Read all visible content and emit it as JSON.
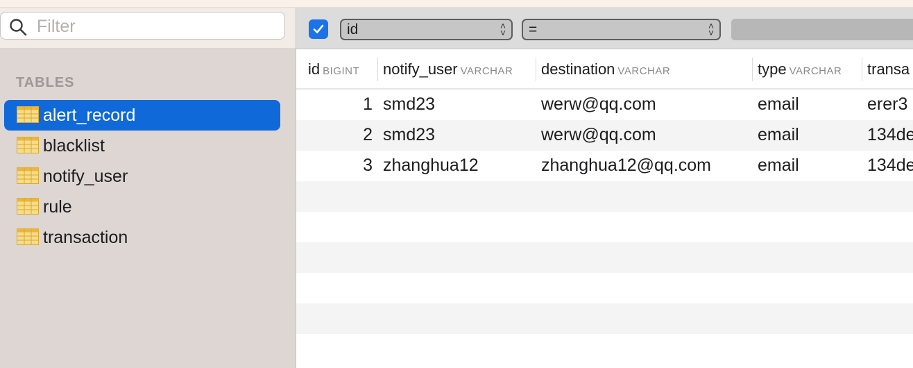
{
  "sidebar": {
    "filter_placeholder": "Filter",
    "section_label": "TABLES",
    "tables": [
      {
        "name": "alert_record",
        "selected": true
      },
      {
        "name": "blacklist",
        "selected": false
      },
      {
        "name": "notify_user",
        "selected": false
      },
      {
        "name": "rule",
        "selected": false
      },
      {
        "name": "transaction",
        "selected": false
      }
    ]
  },
  "filter_bar": {
    "enabled": true,
    "field": "id",
    "operator": "=",
    "value": ""
  },
  "grid": {
    "columns": [
      {
        "name": "id",
        "type": "BIGINT"
      },
      {
        "name": "notify_user",
        "type": "VARCHAR"
      },
      {
        "name": "destination",
        "type": "VARCHAR"
      },
      {
        "name": "type",
        "type": "VARCHAR"
      },
      {
        "name": "transa",
        "type": ""
      }
    ],
    "rows": [
      {
        "id": "1",
        "notify_user": "smd23",
        "destination": "werw@qq.com",
        "type": "email",
        "transaction": "erer3"
      },
      {
        "id": "2",
        "notify_user": "smd23",
        "destination": "werw@qq.com",
        "type": "email",
        "transaction": "134de"
      },
      {
        "id": "3",
        "notify_user": "zhanghua12",
        "destination": "zhanghua12@qq.com",
        "type": "email",
        "transaction": "134de"
      }
    ]
  },
  "colors": {
    "selection": "#1069d9",
    "checkbox": "#1a73e8",
    "sidebar_bg": "#ddd6d2"
  }
}
